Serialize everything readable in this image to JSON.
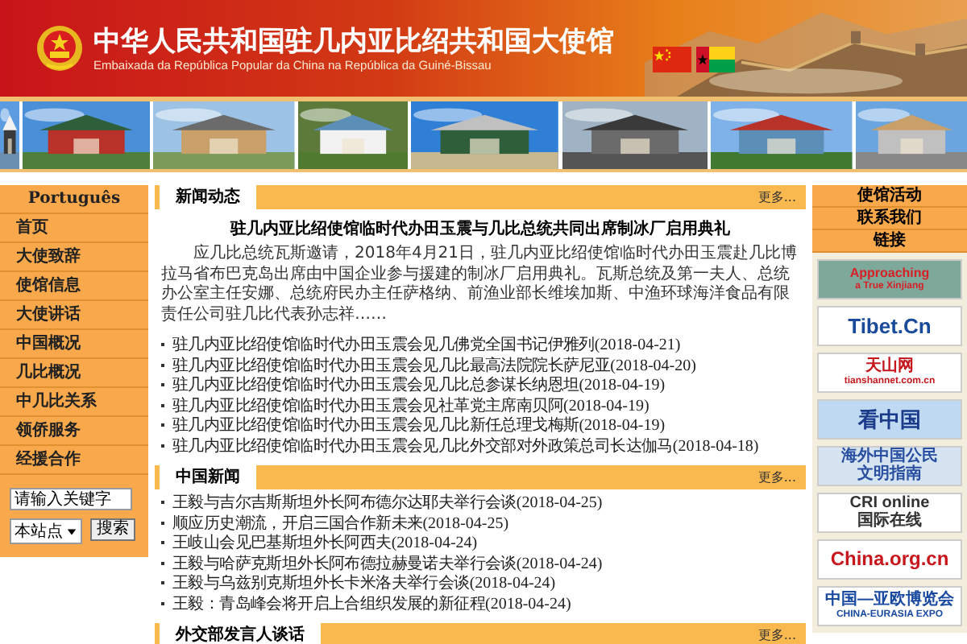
{
  "header": {
    "title": "中华人民共和国驻几内亚比绍共和国大使馆",
    "subtitle": "Embaixada da República Popular da China na República da Guiné-Bissau"
  },
  "sidebar": {
    "language": "Português",
    "items": [
      "首页",
      "大使致辞",
      "使馆信息",
      "大使讲话",
      "中国概况",
      "几比概况",
      "中几比关系",
      "领侨服务",
      "经援合作"
    ],
    "search": {
      "value": "请输入关键字",
      "scope": "本站点",
      "button": "搜索"
    }
  },
  "sections": [
    {
      "title": "新闻动态",
      "more": "更多...",
      "headline": "驻几内亚比绍使馆临时代办田玉震与几比总统共同出席制冰厂启用典礼",
      "summary": "应几比总统瓦斯邀请，2018年4月21日，驻几内亚比绍使馆临时代办田玉震赴几比博拉马省布巴克岛出席由中国企业参与援建的制冰厂启用典礼。瓦斯总统及第一夫人、总统办公室主任安娜、总统府民办主任萨格纳、前渔业部长维埃加斯、中渔环球海洋食品有限责任公司驻几比代表孙志祥……",
      "items": [
        {
          "text": "驻几内亚比绍使馆临时代办田玉震会见几佛党全国书记伊雅列",
          "date": "(2018-04-21)"
        },
        {
          "text": "驻几内亚比绍使馆临时代办田玉震会见几比最高法院院长萨尼亚",
          "date": "(2018-04-20)"
        },
        {
          "text": "驻几内亚比绍使馆临时代办田玉震会见几比总参谋长纳恩坦",
          "date": "(2018-04-19)"
        },
        {
          "text": "驻几内亚比绍使馆临时代办田玉震会见社革党主席南贝阿",
          "date": "(2018-04-19)"
        },
        {
          "text": "驻几内亚比绍使馆临时代办田玉震会见几比新任总理戈梅斯",
          "date": "(2018-04-19)"
        },
        {
          "text": "驻几内亚比绍使馆临时代办田玉震会见几比外交部对外政策总司长达伽马",
          "date": "(2018-04-18)"
        }
      ]
    },
    {
      "title": "中国新闻",
      "more": "更多...",
      "items": [
        {
          "text": "王毅与吉尔吉斯斯坦外长阿布德尔达耶夫举行会谈",
          "date": "(2018-04-25)"
        },
        {
          "text": "顺应历史潮流，开启三国合作新未来",
          "date": "(2018-04-25)"
        },
        {
          "text": "王岐山会见巴基斯坦外长阿西夫",
          "date": "(2018-04-24)"
        },
        {
          "text": "王毅与哈萨克斯坦外长阿布德拉赫曼诺夫举行会谈",
          "date": "(2018-04-24)"
        },
        {
          "text": "王毅与乌兹别克斯坦外长卡米洛夫举行会谈",
          "date": "(2018-04-24)"
        },
        {
          "text": "王毅：青岛峰会将开启上合组织发展的新征程",
          "date": "(2018-04-24)"
        }
      ]
    },
    {
      "title": "外交部发言人谈话",
      "more": "更多..."
    }
  ],
  "right_menu": [
    "使馆活动",
    "联系我们",
    "链接"
  ],
  "banners": [
    {
      "kind": "xinjiang",
      "lines": [
        "Approaching",
        "a True Xinjiang"
      ]
    },
    {
      "kind": "tibet",
      "lines": [
        "Tibet.Cn"
      ]
    },
    {
      "kind": "tianshan",
      "lines": [
        "天山网",
        "tianshannet.com.cn"
      ]
    },
    {
      "kind": "showchina",
      "lines": [
        "看中国"
      ]
    },
    {
      "kind": "civil",
      "lines": [
        "海外中国公民",
        "文明指南"
      ]
    },
    {
      "kind": "cri",
      "lines": [
        "CRI online",
        "国际在线"
      ]
    },
    {
      "kind": "chinaorg",
      "lines": [
        "China.org.cn"
      ]
    },
    {
      "kind": "expo",
      "lines": [
        "中国—亚欧博览会",
        "CHINA-EURASIA EXPO"
      ]
    }
  ]
}
